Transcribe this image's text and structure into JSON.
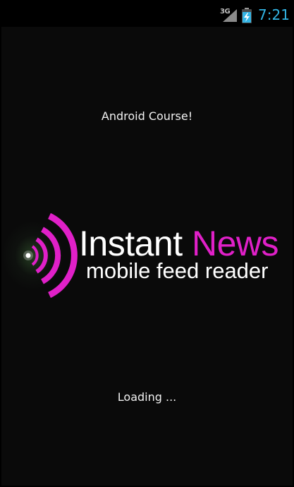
{
  "status_bar": {
    "network": "3G",
    "time": "7:21",
    "signal_icon": "signal-strength-icon",
    "battery_icon": "battery-charging-icon"
  },
  "app_title": "Android Course!",
  "logo": {
    "brand_first": "Instant",
    "brand_second": "News",
    "tagline": "mobile feed reader",
    "icon": "broadcast-waves-icon",
    "accent_color": "#e020c8"
  },
  "loading_text": "Loading ...",
  "colors": {
    "background": "#0a0a0a",
    "clock": "#33b5e5",
    "text": "#f2f2f2"
  }
}
